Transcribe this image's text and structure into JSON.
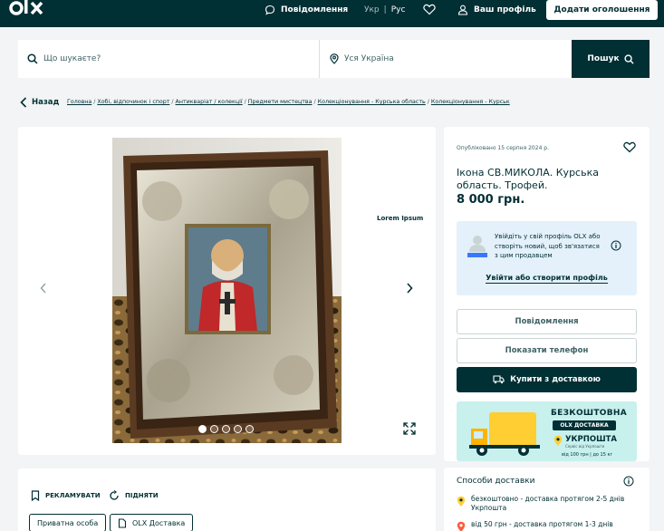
{
  "header": {
    "messages_label": "Повідомлення",
    "lang_ukr": "Укр",
    "lang_rus": "Рус",
    "profile_label": "Ваш профіль",
    "add_button_label": "Додати оголошення"
  },
  "search": {
    "placeholder": "Що шукаєте?",
    "location": "Уся Україна",
    "button_label": "Пошук"
  },
  "breadcrumb": {
    "back_label": "Назад",
    "items": [
      "Головна",
      "Хобі, відпочинок і спорт",
      "Антикваріат / колекції",
      "Предмети мистецтва",
      "Колекціонування - Курська область",
      "Колекціонування - Курськ"
    ]
  },
  "gallery": {
    "watermark": "Lorem Ipsum",
    "photo_count": 5,
    "active_photo": 1
  },
  "ad": {
    "published": "Опубліковано 15 серпня 2024 р.",
    "title": "Ікона СВ.МИКОЛА. Курська область. Трофей.",
    "price": "8 000 грн.",
    "profile_prompt": "Увійдіть у свій профіль OLX або створіть новий, щоб зв'язатися з цим продавцем",
    "profile_link": "Увійти або створити профіль",
    "message_button": "Повідомлення",
    "phone_button": "Показати телефон",
    "buy_button": "Купити з доставкою"
  },
  "banner": {
    "title": "БЕЗКОШТОВНА",
    "badge": "OLX ДОСТАВКА",
    "carrier": "УКРПОШТА",
    "carrier_sub": "Сервіс від Укрпошти",
    "note": "від 100 грн | до 15 кг"
  },
  "promo": {
    "advertise_label": "РЕКЛАМУВАТИ",
    "raise_label": "ПІДНЯТИ",
    "tag_private": "Приватна особа",
    "tag_delivery": "OLX Доставка"
  },
  "delivery": {
    "title": "Способи доставки",
    "rows": [
      {
        "text": "безкоштовно - доставка протягом 2-5 днів",
        "carrier": "Укрпошта"
      },
      {
        "text": "від 50 грн - доставка протягом 1-3 днів"
      }
    ]
  },
  "colors": {
    "brand_dark": "#002f34",
    "page_bg": "#f2f4f5",
    "banner_bg": "#c8f0ed",
    "profile_bg": "#e4f1fb",
    "accent_yellow": "#ffce32"
  }
}
